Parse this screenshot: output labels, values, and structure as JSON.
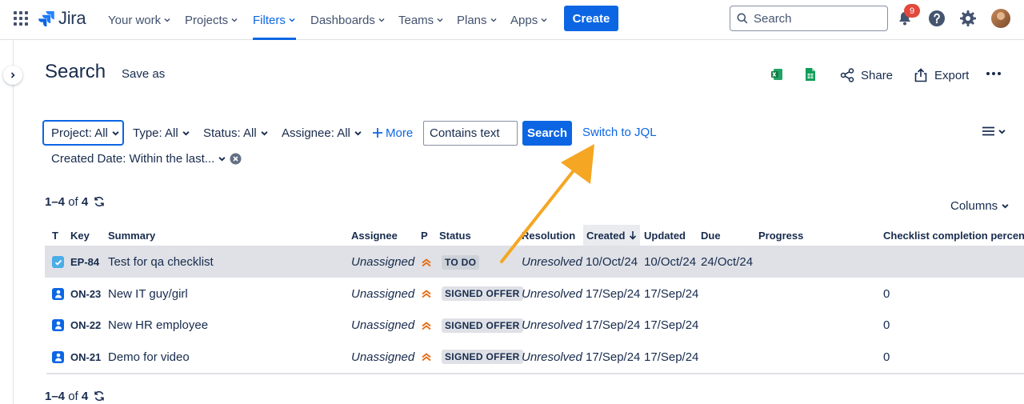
{
  "nav": {
    "logo": "Jira",
    "items": [
      {
        "label": "Your work"
      },
      {
        "label": "Projects"
      },
      {
        "label": "Filters"
      },
      {
        "label": "Dashboards"
      },
      {
        "label": "Teams"
      },
      {
        "label": "Plans"
      },
      {
        "label": "Apps"
      }
    ],
    "active_item": "Filters",
    "create_label": "Create",
    "search_placeholder": "Search",
    "notifications_count": "9"
  },
  "header": {
    "title": "Search",
    "save_as": "Save as",
    "share": "Share",
    "export": "Export"
  },
  "filters": {
    "project": "Project: All",
    "type": "Type: All",
    "status": "Status: All",
    "assignee": "Assignee: All",
    "more": "More",
    "text_placeholder": "Contains text",
    "search_button": "Search",
    "switch_jql": "Switch to JQL",
    "created_date": "Created Date: Within the last..."
  },
  "results": {
    "range": "1–4",
    "of": "of",
    "total": "4",
    "columns_label": "Columns"
  },
  "table": {
    "headers": {
      "t": "T",
      "key": "Key",
      "summary": "Summary",
      "assignee": "Assignee",
      "p": "P",
      "status": "Status",
      "resolution": "Resolution",
      "created": "Created",
      "updated": "Updated",
      "due": "Due",
      "progress": "Progress",
      "checklist": "Checklist completion percenta"
    },
    "rows": [
      {
        "type": "task",
        "key": "EP-84",
        "summary": "Test for qa checklist",
        "assignee": "Unassigned",
        "status": "TO DO",
        "resolution": "Unresolved",
        "created": "10/Oct/24",
        "updated": "10/Oct/24",
        "due": "24/Oct/24",
        "checklist": ""
      },
      {
        "type": "person",
        "key": "ON-23",
        "summary": "New IT guy/girl",
        "assignee": "Unassigned",
        "status": "SIGNED OFFER",
        "resolution": "Unresolved",
        "created": "17/Sep/24",
        "updated": "17/Sep/24",
        "due": "",
        "checklist": "0"
      },
      {
        "type": "person",
        "key": "ON-22",
        "summary": "New HR employee",
        "assignee": "Unassigned",
        "status": "SIGNED OFFER",
        "resolution": "Unresolved",
        "created": "17/Sep/24",
        "updated": "17/Sep/24",
        "due": "",
        "checklist": "0"
      },
      {
        "type": "person",
        "key": "ON-21",
        "summary": "Demo for video",
        "assignee": "Unassigned",
        "status": "SIGNED OFFER",
        "resolution": "Unresolved",
        "created": "17/Sep/24",
        "updated": "17/Sep/24",
        "due": "",
        "checklist": "0"
      }
    ]
  },
  "colors": {
    "accent": "#0c66e4",
    "priority": "#e56910",
    "annotation_arrow": "#f5a623",
    "task_icon": "#4bade8",
    "person_icon": "#0c66e4"
  }
}
